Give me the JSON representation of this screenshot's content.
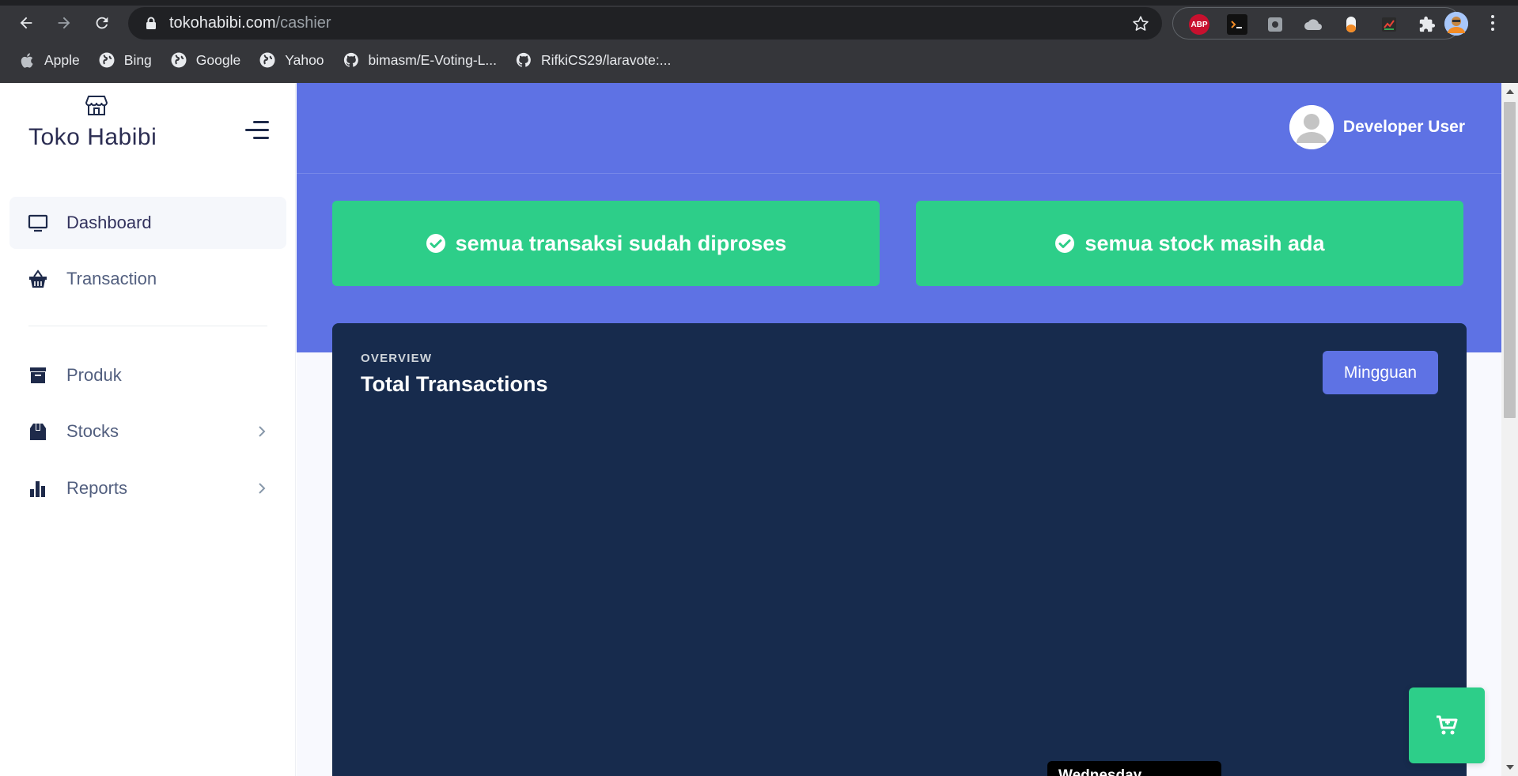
{
  "browser": {
    "url_host": "tokohabibi.com",
    "url_path": "/cashier",
    "bookmarks": [
      {
        "label": "Apple",
        "icon": "apple-icon"
      },
      {
        "label": "Bing",
        "icon": "globe-icon"
      },
      {
        "label": "Google",
        "icon": "globe-icon"
      },
      {
        "label": "Yahoo",
        "icon": "globe-icon"
      },
      {
        "label": "bimasm/E-Voting-L...",
        "icon": "github-icon"
      },
      {
        "label": "RifkiCS29/laravote:...",
        "icon": "github-icon"
      }
    ],
    "extensions": {
      "abp_label": "ABP"
    }
  },
  "sidebar": {
    "brand": "Toko Habibi",
    "items": [
      {
        "label": "Dashboard",
        "icon": "monitor-icon",
        "active": true
      },
      {
        "label": "Transaction",
        "icon": "basket-icon",
        "active": false
      },
      {
        "label": "Produk",
        "icon": "archive-icon",
        "active": false
      },
      {
        "label": "Stocks",
        "icon": "box-icon",
        "active": false
      },
      {
        "label": "Reports",
        "icon": "bar-chart-icon",
        "active": false
      }
    ]
  },
  "header": {
    "user_name": "Developer User"
  },
  "alerts": [
    {
      "text": "semua transaksi sudah diproses"
    },
    {
      "text": "semua stock masih ada"
    }
  ],
  "card": {
    "overline": "OVERVIEW",
    "title": "Total Transactions",
    "toggle_label": "Mingguan",
    "tooltip_label": "Wednesday"
  },
  "colors": {
    "primary": "#5e72e4",
    "success": "#2dce89",
    "dark": "#172b4d"
  }
}
